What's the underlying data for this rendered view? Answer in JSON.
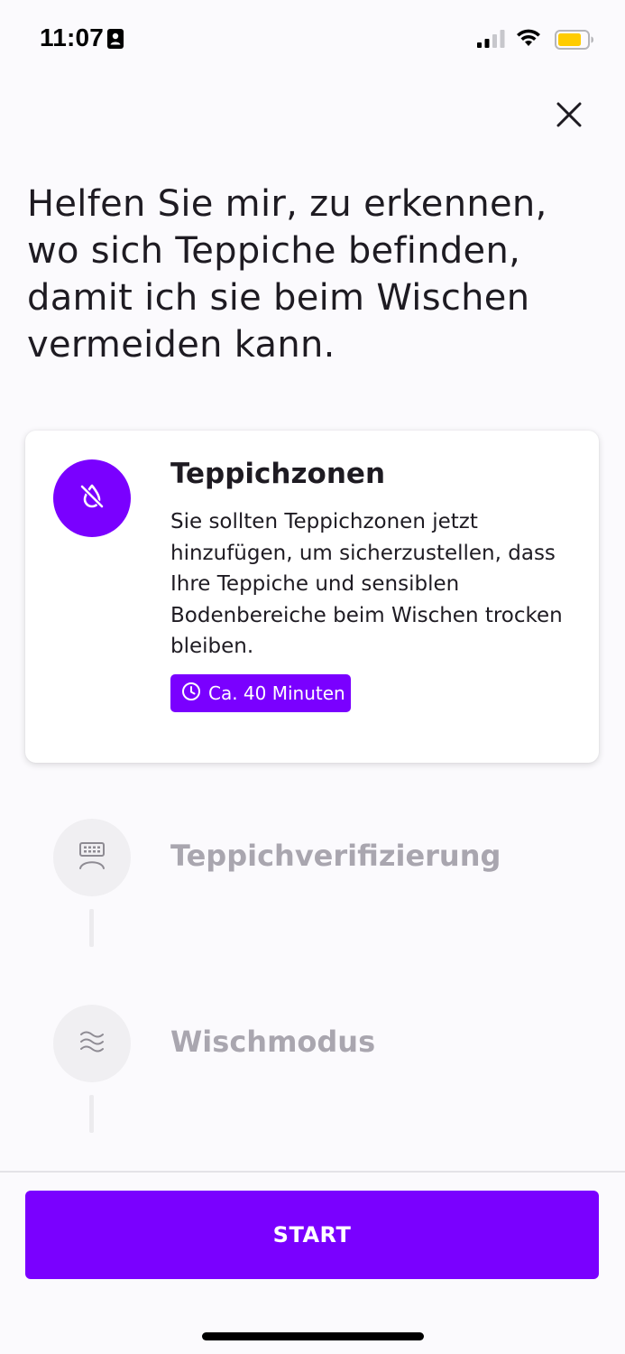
{
  "status_bar": {
    "time": "11:07",
    "badge_icon": "id-card-icon",
    "signal_icon": "cellular-signal-icon",
    "wifi_icon": "wifi-icon",
    "battery_icon": "battery-icon",
    "battery_color": "#FFCC00"
  },
  "header": {
    "close_icon": "close-icon"
  },
  "page": {
    "title": "Helfen Sie mir, zu erkennen, wo sich Teppiche befinden, damit ich sie beim Wischen vermeiden kann."
  },
  "steps": [
    {
      "title": "Teppichzonen",
      "icon": "no-water-drop-icon",
      "state": "active",
      "description": "Sie sollten Teppichzonen jetzt hinzufügen, um sicherzustellen, dass Ihre Teppiche und sensiblen Bodenbereiche beim Wischen trocken bleiben.",
      "duration_icon": "clock-icon",
      "duration": "Ca. 40 Minuten"
    },
    {
      "title": "Teppichverifizierung",
      "icon": "carpet-verify-icon",
      "state": "inactive"
    },
    {
      "title": "Wischmodus",
      "icon": "wave-mop-icon",
      "state": "inactive"
    }
  ],
  "footer": {
    "start_label": "START"
  },
  "colors": {
    "accent": "#7A00FF",
    "inactive_text": "#A9A6AF",
    "background": "#FBFAFD"
  }
}
